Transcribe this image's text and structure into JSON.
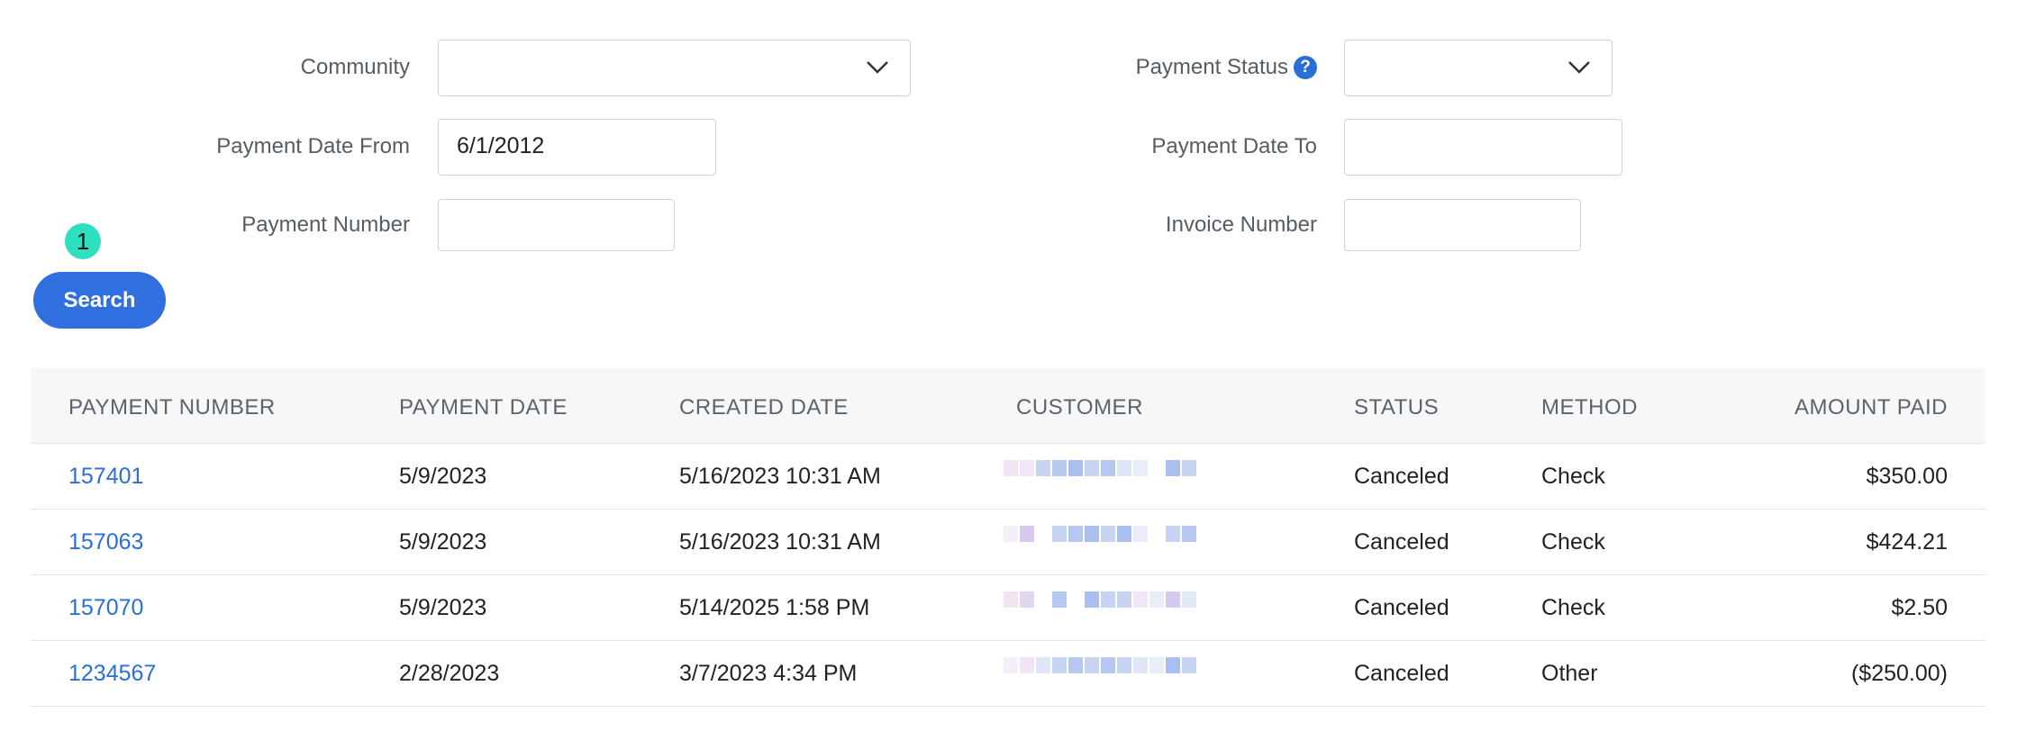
{
  "filters": {
    "community": {
      "label": "Community",
      "value": ""
    },
    "payment_status": {
      "label": "Payment Status",
      "value": ""
    },
    "payment_date_from": {
      "label": "Payment Date From",
      "value": "6/1/2012"
    },
    "payment_date_to": {
      "label": "Payment Date To",
      "value": ""
    },
    "payment_number": {
      "label": "Payment Number",
      "value": ""
    },
    "invoice_number": {
      "label": "Invoice Number",
      "value": ""
    },
    "help_glyph": "?"
  },
  "step_badge": "1",
  "search_label": "Search",
  "table": {
    "headers": {
      "payment_number": "PAYMENT NUMBER",
      "payment_date": "PAYMENT DATE",
      "created_date": "CREATED DATE",
      "customer": "CUSTOMER",
      "status": "STATUS",
      "method": "METHOD",
      "amount_paid": "AMOUNT PAID"
    },
    "rows": [
      {
        "payment_number": "157401",
        "payment_date": "5/9/2023",
        "created_date": "5/16/2023 10:31 AM",
        "status": "Canceled",
        "method": "Check",
        "amount_paid": "$350.00"
      },
      {
        "payment_number": "157063",
        "payment_date": "5/9/2023",
        "created_date": "5/16/2023 10:31 AM",
        "status": "Canceled",
        "method": "Check",
        "amount_paid": "$424.21"
      },
      {
        "payment_number": "157070",
        "payment_date": "5/9/2023",
        "created_date": "5/14/2025 1:58 PM",
        "status": "Canceled",
        "method": "Check",
        "amount_paid": "$2.50"
      },
      {
        "payment_number": "1234567",
        "payment_date": "2/28/2023",
        "created_date": "3/7/2023 4:34 PM",
        "status": "Canceled",
        "method": "Other",
        "amount_paid": "($250.00)"
      }
    ]
  },
  "colors": {
    "accent": "#2f6fe0",
    "link": "#2a6ed6",
    "badge": "#2fe0c0"
  }
}
